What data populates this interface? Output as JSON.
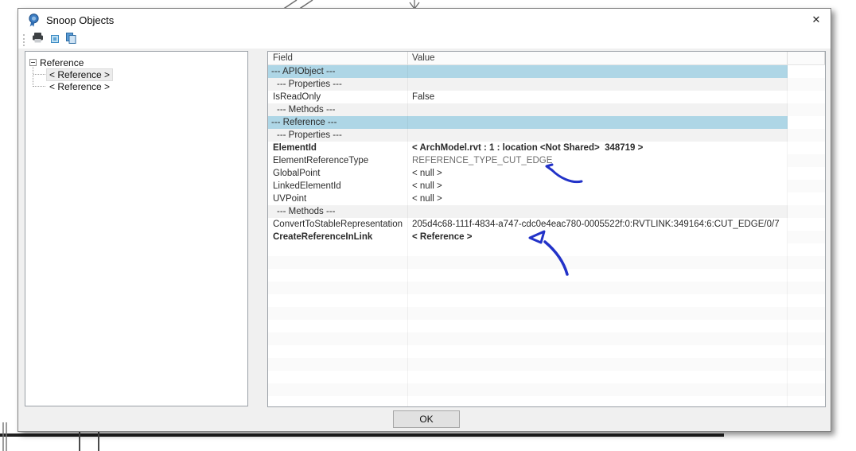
{
  "window": {
    "title": "Snoop Objects",
    "close_glyph": "✕"
  },
  "toolbar": {
    "icons": [
      "print-icon",
      "print-preview-icon",
      "copy-icon"
    ]
  },
  "tree": {
    "root_label": "Reference",
    "children": [
      "< Reference >",
      "< Reference >"
    ],
    "selected_index": 0
  },
  "grid": {
    "columns": [
      "Field",
      "Value"
    ],
    "rows": [
      {
        "field": "--- APIObject ---",
        "value": "",
        "style": "section"
      },
      {
        "field": "--- Properties ---",
        "value": "",
        "style": "subsection"
      },
      {
        "field": "IsReadOnly",
        "value": "False",
        "style": "normal"
      },
      {
        "field": "--- Methods ---",
        "value": "",
        "style": "subsection"
      },
      {
        "field": "--- Reference ---",
        "value": "",
        "style": "section"
      },
      {
        "field": "--- Properties ---",
        "value": "",
        "style": "subsection"
      },
      {
        "field": "ElementId",
        "value": "< ArchModel.rvt : 1 : location <Not Shared>  348719 >",
        "style": "bold"
      },
      {
        "field": "ElementReferenceType",
        "value": "REFERENCE_TYPE_CUT_EDGE",
        "style": "muted"
      },
      {
        "field": "GlobalPoint",
        "value": "< null >",
        "style": "normal"
      },
      {
        "field": "LinkedElementId",
        "value": "< null >",
        "style": "normal"
      },
      {
        "field": "UVPoint",
        "value": "< null >",
        "style": "normal"
      },
      {
        "field": "--- Methods ---",
        "value": "",
        "style": "subsection"
      },
      {
        "field": "ConvertToStableRepresentation",
        "value": "205d4c68-111f-4834-a747-cdc0e4eac780-0005522f:0:RVTLINK:349164:6:CUT_EDGE/0/7",
        "style": "normal"
      },
      {
        "field": "CreateReferenceInLink",
        "value": "< Reference >",
        "style": "bold"
      }
    ],
    "filler_row_count": 13
  },
  "footer": {
    "ok_label": "OK"
  },
  "colors": {
    "section_highlight": "#aed6e6",
    "annotation_blue": "#2232c8"
  },
  "annotations": {
    "type": "hand-drawn-arrows",
    "count": 2,
    "color": "#2232c8",
    "targets": [
      "REFERENCE_TYPE_CUT_EDGE value",
      "RVTLINK:349164 segment of ConvertToStableRepresentation value"
    ]
  }
}
